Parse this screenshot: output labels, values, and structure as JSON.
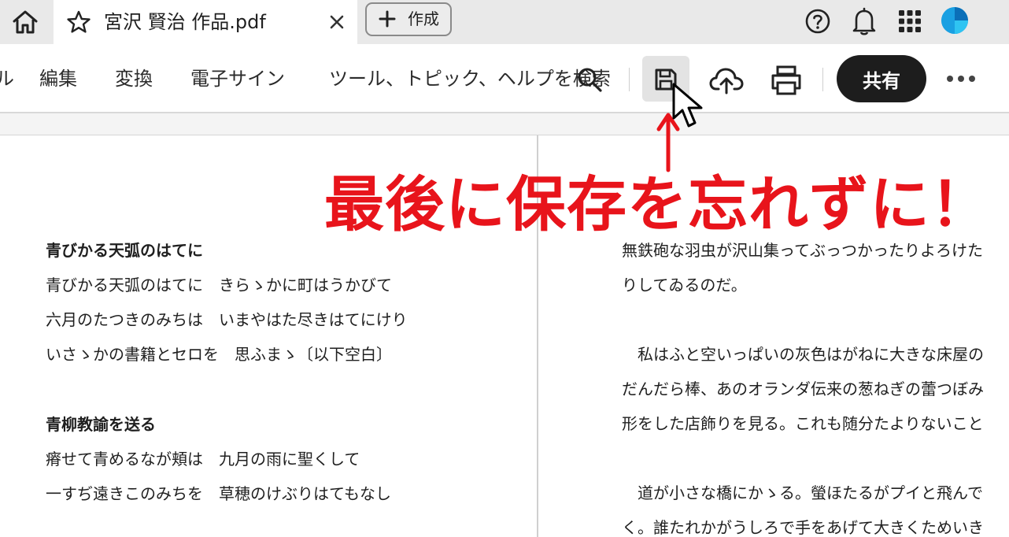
{
  "titlebar": {
    "tab_title": "宮沢 賢治 作品.pdf",
    "create_label": "作成"
  },
  "toolbar": {
    "partial_item": "ル",
    "menu_items": [
      "編集",
      "変換",
      "電子サイン"
    ],
    "search_text": "ツール、トピック、ヘルプを検索",
    "share_label": "共有"
  },
  "left_page": {
    "poem1_title": "青びかる天弧のはてに",
    "poem1_lines": [
      "青びかる天弧のはてに　きらゝかに町はうかびて",
      "六月のたつきのみちは　いまやはた尽きはてにけり",
      "いさゝかの書籍とセロを　思ふまゝ〔以下空白〕"
    ],
    "poem2_title": "青柳教諭を送る",
    "poem2_lines": [
      "瘠せて青めるなが頬は　九月の雨に聖くして",
      "一すぢ遠きこのみちを　草穂のけぶりはてもなし"
    ]
  },
  "right_page": {
    "lines": [
      "無鉄砲な羽虫が沢山集ってぶっつかったりよろけた",
      "りしてゐるのだ。",
      "",
      "　私はふと空いっぱいの灰色はがねに大きな床屋の",
      "だんだら棒、あのオランダ伝来の葱ねぎの蕾つぼみ",
      "形をした店飾りを見る。これも随分たよりないこと",
      "",
      "　道が小さな橋にかゝる。螢ほたるがプイと飛んで",
      "く。誰たれかがうしろで手をあげて大きくためいき"
    ]
  },
  "annotation": {
    "text": "最後に保存を忘れずに！",
    "color": "#e8141b"
  },
  "colors": {
    "titlebar_bg": "#e9e9e9",
    "share_bg": "#1d1d1d",
    "avatar": "#1a9fe0"
  }
}
